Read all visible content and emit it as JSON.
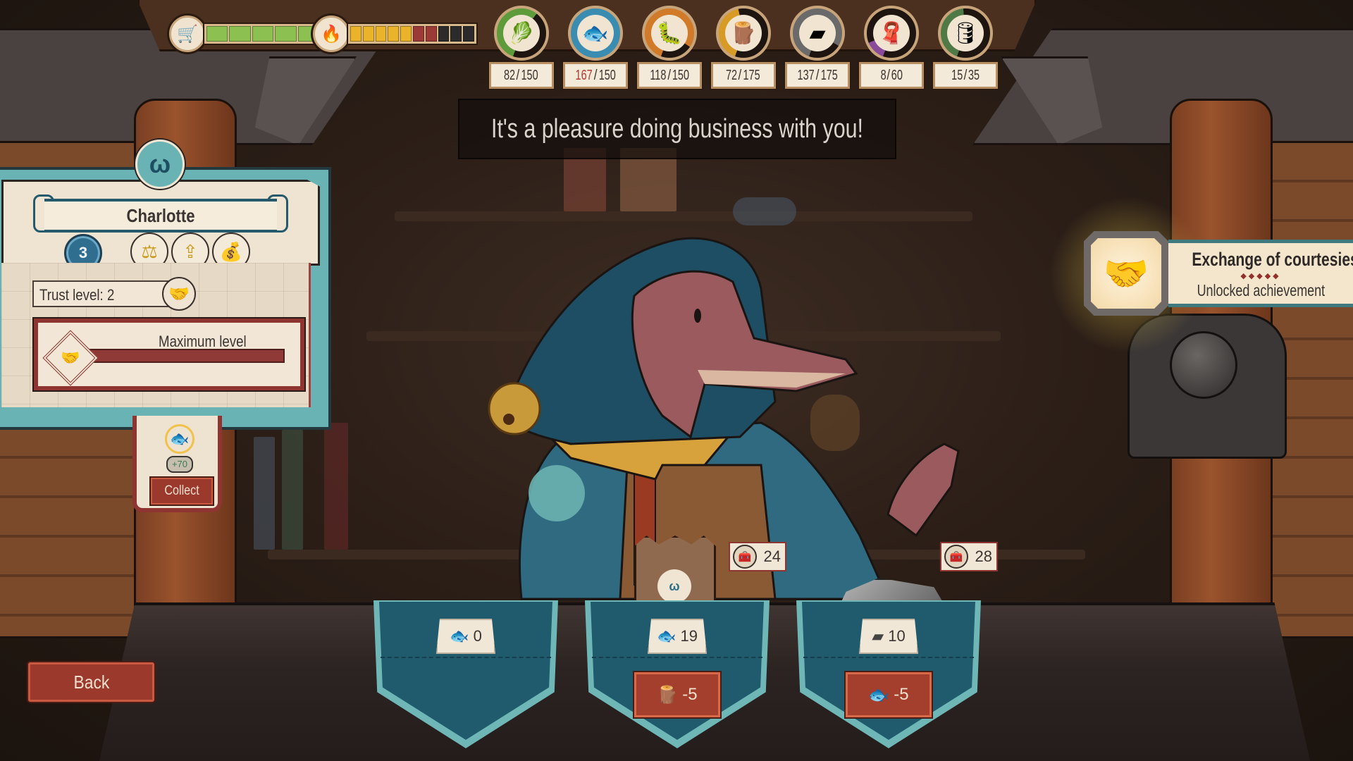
{
  "hud": {
    "caravan_health": {
      "icon": "caravan-icon",
      "fraction": 1.0,
      "segments_filled": 5,
      "segments_total": 5,
      "color": "#8cc152"
    },
    "heat": {
      "icon": "flame-icon",
      "segments": [
        "#e9b32a",
        "#e9b32a",
        "#e9b32a",
        "#e9b32a",
        "#e9b32a",
        "#9b3a37",
        "#9b3a37",
        "#2b2b2b",
        "#2b2b2b",
        "#2b2b2b"
      ]
    },
    "resources": [
      {
        "name": "cabbage",
        "icon": "🥬",
        "current": "82",
        "max": "150",
        "ring_color": "#5e9b3a",
        "fraction": 0.55,
        "over": false
      },
      {
        "name": "fish",
        "icon": "🐟",
        "current": "167",
        "max": "150",
        "ring_color": "#3a8db0",
        "fraction": 1.0,
        "over": true
      },
      {
        "name": "grub",
        "icon": "🐛",
        "current": "118",
        "max": "150",
        "ring_color": "#d07a2a",
        "fraction": 0.79,
        "over": false
      },
      {
        "name": "wood",
        "icon": "🪵",
        "current": "72",
        "max": "175",
        "ring_color": "#d69a25",
        "fraction": 0.41,
        "over": false
      },
      {
        "name": "iron",
        "icon": "▰",
        "current": "137",
        "max": "175",
        "ring_color": "#6a6a6a",
        "fraction": 0.78,
        "over": false
      },
      {
        "name": "fabric",
        "icon": "🧣",
        "current": "8",
        "max": "60",
        "ring_color": "#8a4a9a",
        "fraction": 0.13,
        "over": false
      },
      {
        "name": "barrel",
        "icon": "🛢",
        "current": "15",
        "max": "35",
        "ring_color": "#4f7a45",
        "fraction": 0.43,
        "over": false
      }
    ]
  },
  "dialogue": "It's a pleasure doing business with you!",
  "merchant": {
    "name": "Charlotte",
    "portrait_icon": "ω",
    "level": "3",
    "perks": [
      "scale-perk-icon",
      "chest-upgrade-perk-icon",
      "money-bag-perk-icon"
    ],
    "trust_label": "Trust level: 2",
    "max_level_label": "Maximum level",
    "trust_progress": 1.0
  },
  "collect": {
    "icon": "🐟",
    "amount": "+70",
    "button_label": "Collect"
  },
  "achievement": {
    "title": "Exchange of courtesies",
    "dots": "◆◆◆◆◆",
    "subtitle": "Unlocked achievement",
    "icon": "🤝"
  },
  "trades": [
    {
      "item_icon": "🐟",
      "item_name": "fish",
      "stock": "0",
      "cost": null,
      "price": null
    },
    {
      "item_icon": "🐟",
      "item_name": "fish",
      "stock": "19",
      "cost": {
        "icon": "🪵",
        "name": "wood",
        "amount": "-5"
      },
      "price": "24"
    },
    {
      "item_icon": "▰",
      "item_name": "iron",
      "stock": "10",
      "cost": {
        "icon": "🐟",
        "name": "fish",
        "amount": "-5"
      },
      "price": "28"
    }
  ],
  "back_label": "Back"
}
